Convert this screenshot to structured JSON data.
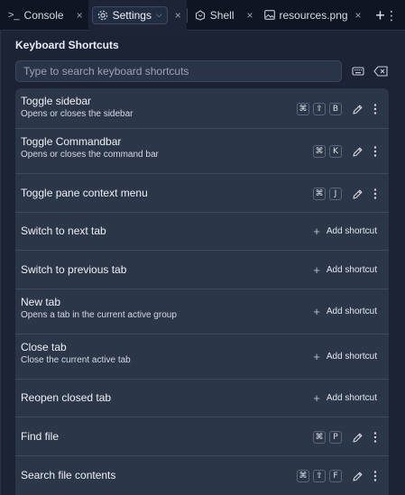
{
  "tabs": [
    {
      "label": "Console",
      "icon": "terminal-icon",
      "close": "×"
    },
    {
      "label": "Settings",
      "icon": "gear-icon",
      "close": "×",
      "caret": "⌵"
    },
    {
      "label": "Shell",
      "icon": "shell-icon",
      "close": "×"
    },
    {
      "label": "resources.png",
      "icon": "image-icon",
      "close": "×"
    }
  ],
  "tabbar": {
    "add": "+",
    "menu": "⋮"
  },
  "settings": {
    "title": "Keyboard Shortcuts",
    "search_placeholder": "Type to search keyboard shortcuts"
  },
  "add_shortcut_label": "Add shortcut",
  "shortcuts": [
    {
      "label": "Toggle sidebar",
      "desc": "Opens or closes the sidebar",
      "keys": [
        "⌘",
        "⇧",
        "B"
      ]
    },
    {
      "label": "Toggle Commandbar",
      "desc": "Opens or closes the command bar",
      "keys": [
        "⌘",
        "K"
      ]
    },
    {
      "label": "Toggle pane context menu",
      "desc": "",
      "keys": [
        "⌘",
        "J"
      ]
    },
    {
      "label": "Switch to next tab",
      "desc": "",
      "keys": []
    },
    {
      "label": "Switch to previous tab",
      "desc": "",
      "keys": []
    },
    {
      "label": "New tab",
      "desc": "Opens a tab in the current active group",
      "keys": []
    },
    {
      "label": "Close tab",
      "desc": "Close the current active tab",
      "keys": []
    },
    {
      "label": "Reopen closed tab",
      "desc": "",
      "keys": []
    },
    {
      "label": "Find file",
      "desc": "",
      "keys": [
        "⌘",
        "P"
      ]
    },
    {
      "label": "Search file contents",
      "desc": "",
      "keys": [
        "⌘",
        "⇧",
        "F"
      ]
    }
  ],
  "colors": {
    "background": "#1b2335",
    "row": "#2c3649",
    "tabbar": "#0f1522"
  }
}
